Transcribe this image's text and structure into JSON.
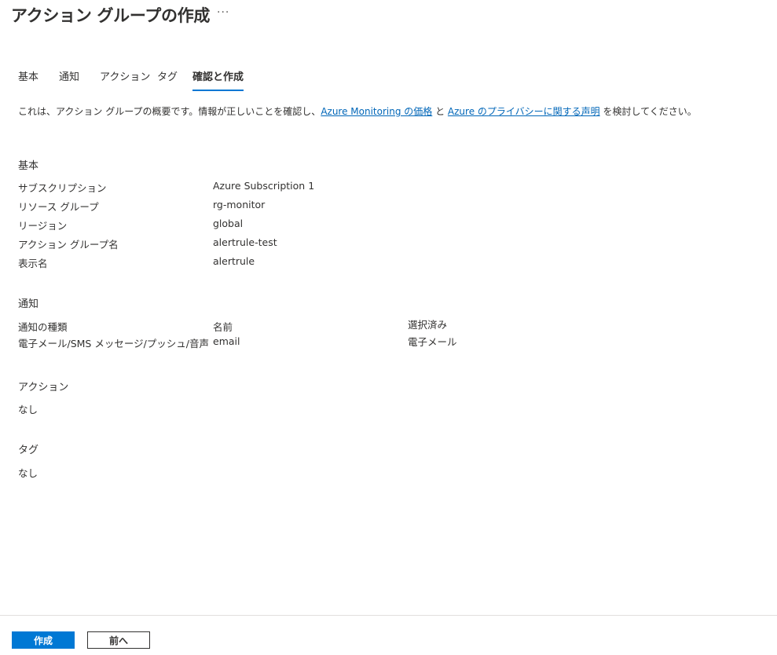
{
  "header": {
    "title": "アクション グループの作成",
    "more": "···"
  },
  "tabs": [
    "基本",
    "通知",
    "アクション",
    "タグ",
    "確認と作成"
  ],
  "intro": {
    "before": "これは、アクション グループの概要です。情報が正しいことを確認し、",
    "link1": "Azure Monitoring の価格",
    "middle": " と ",
    "link2": "Azure のプライバシーに関する声明",
    "after": " を検討してください。"
  },
  "basics": {
    "heading": "基本",
    "rows": [
      {
        "label": "サブスクリプション",
        "value": "Azure Subscription 1"
      },
      {
        "label": "リソース グループ",
        "value": "rg-monitor"
      },
      {
        "label": "リージョン",
        "value": "global"
      },
      {
        "label": "アクション グループ名",
        "value": "alertrule-test"
      },
      {
        "label": "表示名",
        "value": "alertrule"
      }
    ]
  },
  "notifications": {
    "heading": "通知",
    "col_type": "通知の種類",
    "col_name": "名前",
    "col_selected": "選択済み",
    "row": {
      "type": "電子メール/SMS メッセージ/プッシュ/音声",
      "name": "email",
      "selected": "電子メール"
    }
  },
  "actions": {
    "heading": "アクション",
    "value": "なし"
  },
  "tags": {
    "heading": "タグ",
    "value": "なし"
  },
  "footer": {
    "create": "作成",
    "previous": "前へ"
  }
}
